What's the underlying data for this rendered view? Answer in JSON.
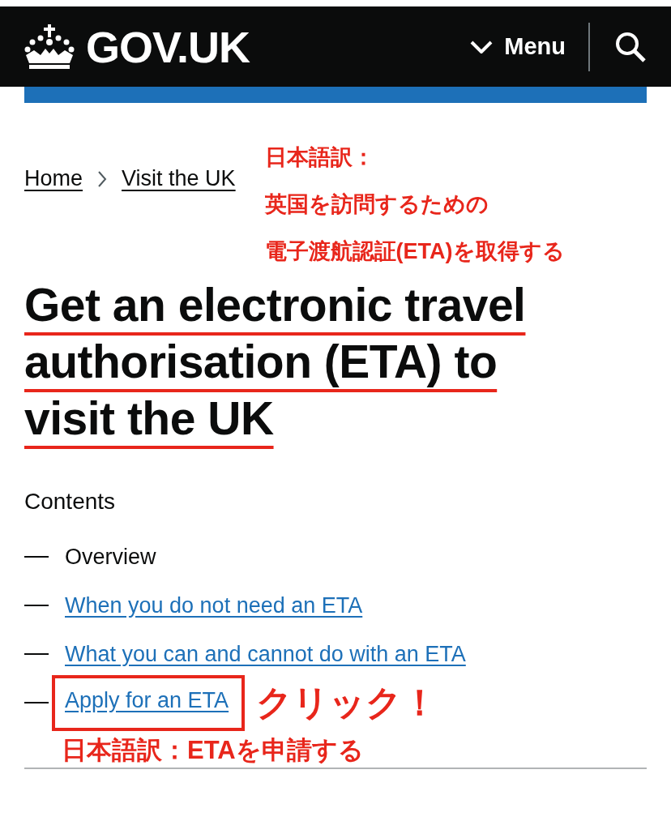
{
  "header": {
    "logo": "GOV.UK",
    "menu": "Menu"
  },
  "breadcrumbs": [
    "Home",
    "Visit the UK"
  ],
  "annotations": {
    "top": [
      "日本語訳：",
      "英国を訪問するための",
      "電子渡航認証(ETA)を取得する"
    ],
    "click": "クリック！",
    "apply_translation": "日本語訳：ETAを申請する"
  },
  "title": "Get an electronic travel authorisation (ETA) to visit the UK",
  "contents": {
    "heading": "Contents",
    "items": [
      {
        "label": "Overview",
        "selected": true,
        "boxed": false
      },
      {
        "label": "When you do not need an ETA",
        "selected": false,
        "boxed": false
      },
      {
        "label": "What you can and cannot do with an ETA",
        "selected": false,
        "boxed": false
      },
      {
        "label": "Apply for an ETA",
        "selected": false,
        "boxed": true
      }
    ]
  }
}
